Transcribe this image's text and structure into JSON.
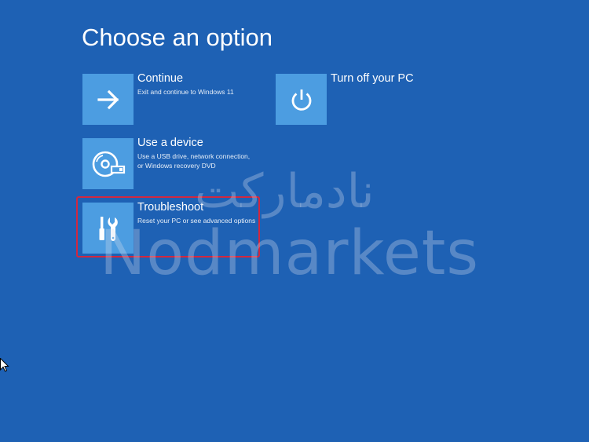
{
  "page": {
    "title": "Choose an option",
    "background_color": "#1e61b4",
    "tile_color": "#4c9de1",
    "highlight_color": "#d1283f"
  },
  "options": [
    {
      "label": "Continue",
      "description": "Exit and continue to Windows 11",
      "icon": "arrow-right-icon"
    },
    {
      "label": "Turn off your PC",
      "description": "",
      "icon": "power-icon"
    },
    {
      "label": "Use a device",
      "description": "Use a USB drive, network connection,\nor Windows recovery DVD",
      "icon": "disc-drive-icon"
    },
    {
      "label": "Troubleshoot",
      "description": "Reset your PC or see advanced options",
      "icon": "tools-icon",
      "highlighted": true
    }
  ],
  "watermark": {
    "latin_text": "Nodmarkets",
    "arabic_text": "نادمارکت"
  }
}
